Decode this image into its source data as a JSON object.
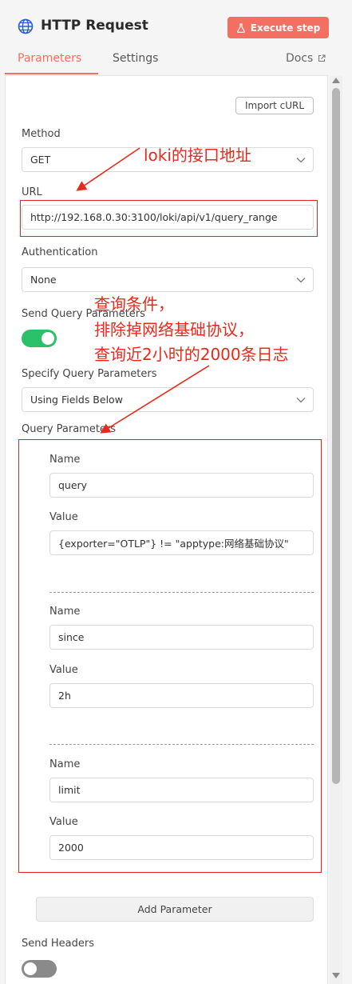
{
  "header": {
    "title": "HTTP Request",
    "execute_label": "Execute step"
  },
  "tabs": {
    "parameters": "Parameters",
    "settings": "Settings",
    "docs": "Docs"
  },
  "import_curl": "Import cURL",
  "method": {
    "label": "Method",
    "value": "GET"
  },
  "url": {
    "label": "URL",
    "value": "http://192.168.0.30:3100/loki/api/v1/query_range"
  },
  "authentication": {
    "label": "Authentication",
    "value": "None"
  },
  "send_query": {
    "label": "Send Query Parameters",
    "enabled": true
  },
  "specify_query": {
    "label": "Specify Query Parameters",
    "value": "Using Fields Below"
  },
  "query_parameters": {
    "label": "Query Parameters",
    "name_label": "Name",
    "value_label": "Value",
    "items": [
      {
        "name": "query",
        "value": "{exporter=\"OTLP\"} != \"apptype:网络基础协议\""
      },
      {
        "name": "since",
        "value": "2h"
      },
      {
        "name": "limit",
        "value": "2000"
      }
    ]
  },
  "add_parameter": "Add Parameter",
  "send_headers": {
    "label": "Send Headers",
    "enabled": false
  },
  "annotations": {
    "url_note": "loki的接口地址",
    "query_note_line1": "查询条件，",
    "query_note_line2": "排除掉网络基础协议，",
    "query_note_line3": "查询近2小时的2000条日志"
  },
  "colors": {
    "accent": "#f36f61",
    "toggle_on": "#2bc06a",
    "annotation": "#e8291c"
  },
  "icons": {
    "title": "globe-icon",
    "execute": "flask-icon",
    "docs": "external-link-icon",
    "dropdown": "chevron-down-icon"
  }
}
